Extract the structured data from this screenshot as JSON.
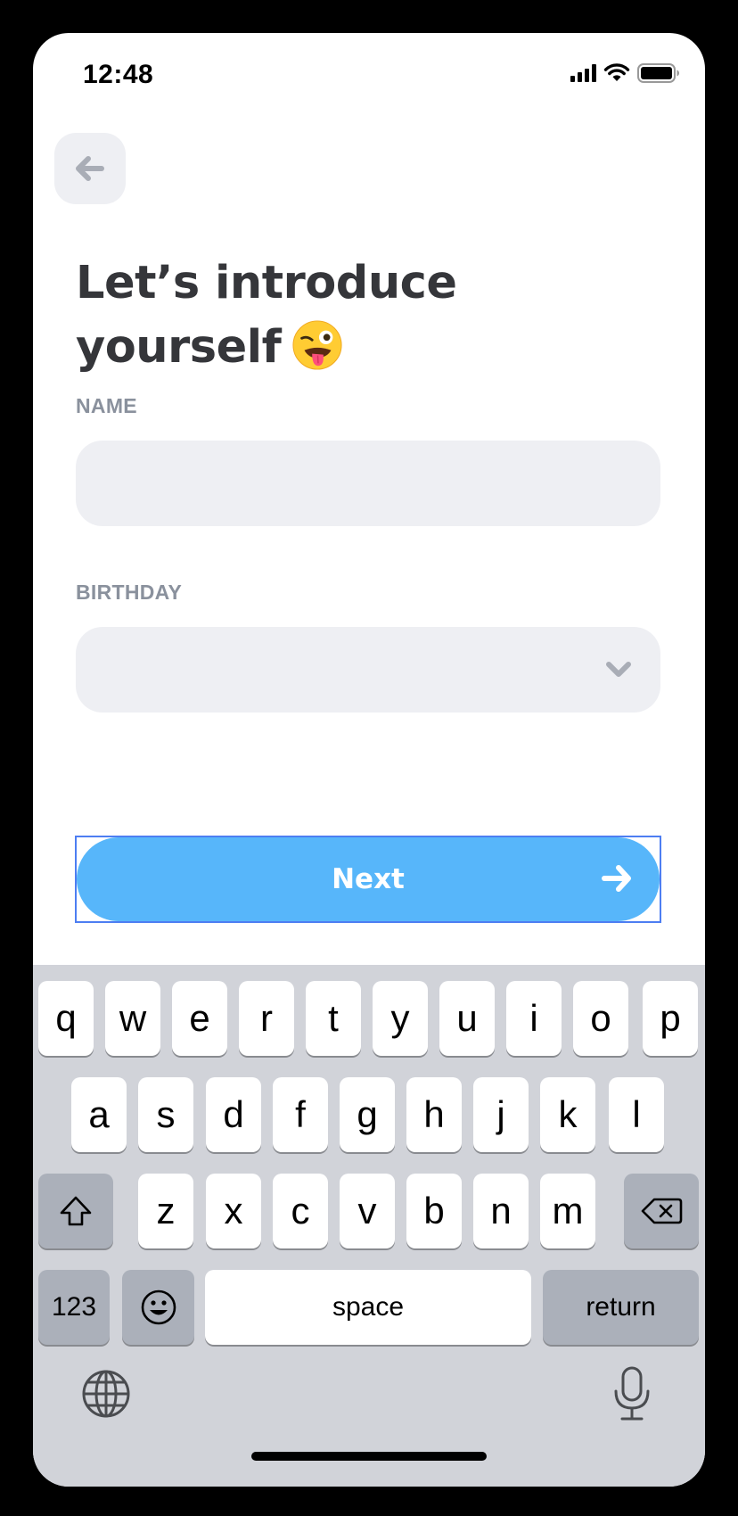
{
  "status_bar": {
    "time": "12:48"
  },
  "header": {
    "back_icon": "arrow-left-icon"
  },
  "title": {
    "line1": "Let’s introduce",
    "line2": "yourself",
    "emoji": "winking-face-with-tongue"
  },
  "form": {
    "name_label": "NAME",
    "name_value": "",
    "birthday_label": "BIRTHDAY",
    "birthday_value": ""
  },
  "next_button": {
    "label": "Next"
  },
  "keyboard": {
    "row1": [
      "q",
      "w",
      "e",
      "r",
      "t",
      "y",
      "u",
      "i",
      "o",
      "p"
    ],
    "row2": [
      "a",
      "s",
      "d",
      "f",
      "g",
      "h",
      "j",
      "k",
      "l"
    ],
    "row3": [
      "z",
      "x",
      "c",
      "v",
      "b",
      "n",
      "m"
    ],
    "numbers_label": "123",
    "space_label": "space",
    "return_label": "return"
  },
  "colors": {
    "accent": "#57b6fa",
    "field_bg": "#eeeff3",
    "title": "#35363a",
    "label": "#8a919d"
  }
}
